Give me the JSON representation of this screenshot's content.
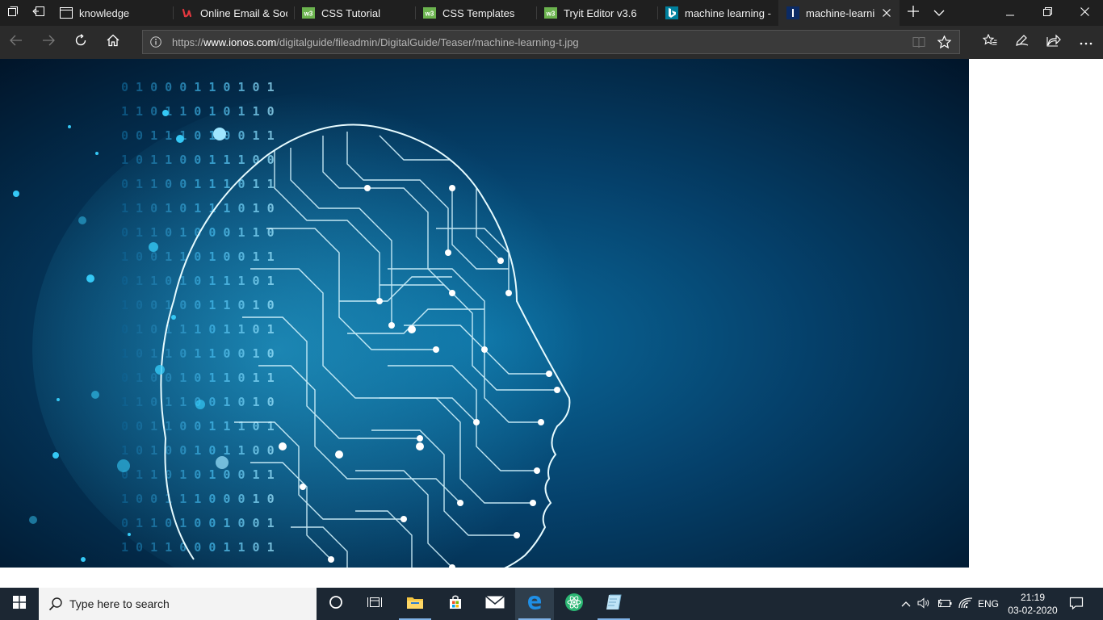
{
  "browser": {
    "tabs": [
      {
        "label": "knowledge",
        "icon": "page-icon",
        "active": false
      },
      {
        "label": "Online Email & Soc",
        "icon": "u-logo-icon",
        "active": false
      },
      {
        "label": "CSS Tutorial",
        "icon": "w3schools-icon",
        "active": false
      },
      {
        "label": "CSS Templates",
        "icon": "w3schools-icon",
        "active": false
      },
      {
        "label": "Tryit Editor v3.6",
        "icon": "w3schools-icon",
        "active": false
      },
      {
        "label": "machine learning -",
        "icon": "bing-icon",
        "active": false
      },
      {
        "label": "machine-learni",
        "icon": "ionos-icon",
        "active": true
      }
    ],
    "address": {
      "scheme": "https://",
      "host": "www.ionos.com",
      "path": "/digitalguide/fileadmin/DigitalGuide/Teaser/machine-learning-t.jpg"
    }
  },
  "content": {
    "image_description": "ai-circuit-head-image",
    "colors": {
      "deep": "#011428",
      "mid": "#0a4c78",
      "glow": "#35c8f5",
      "line": "#d6f6ff"
    }
  },
  "taskbar": {
    "search_placeholder": "Type here to search",
    "apps": [
      "cortana-icon",
      "task-view-icon",
      "file-explorer-icon",
      "store-icon",
      "mail-icon",
      "edge-icon",
      "atom-icon",
      "notes-icon"
    ],
    "language": "ENG",
    "time": "21:19",
    "date": "03-02-2020"
  }
}
